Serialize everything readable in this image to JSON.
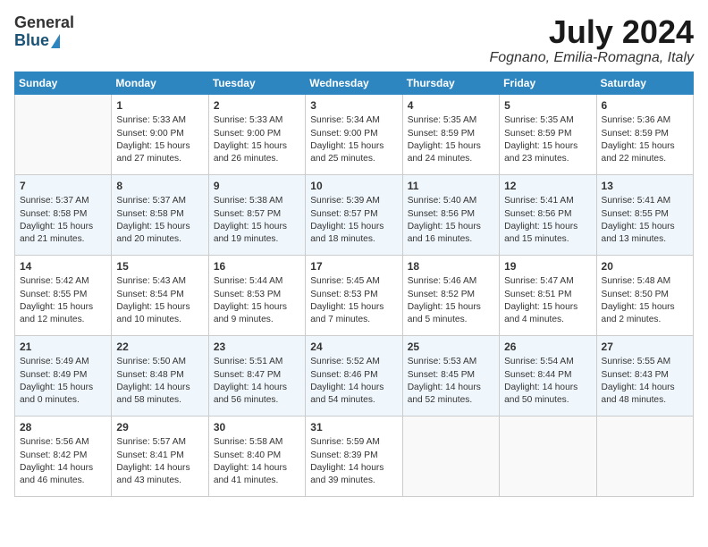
{
  "header": {
    "logo_general": "General",
    "logo_blue": "Blue",
    "month_title": "July 2024",
    "location": "Fognano, Emilia-Romagna, Italy"
  },
  "days_of_week": [
    "Sunday",
    "Monday",
    "Tuesday",
    "Wednesday",
    "Thursday",
    "Friday",
    "Saturday"
  ],
  "weeks": [
    [
      {
        "day": "",
        "info": ""
      },
      {
        "day": "1",
        "info": "Sunrise: 5:33 AM\nSunset: 9:00 PM\nDaylight: 15 hours\nand 27 minutes."
      },
      {
        "day": "2",
        "info": "Sunrise: 5:33 AM\nSunset: 9:00 PM\nDaylight: 15 hours\nand 26 minutes."
      },
      {
        "day": "3",
        "info": "Sunrise: 5:34 AM\nSunset: 9:00 PM\nDaylight: 15 hours\nand 25 minutes."
      },
      {
        "day": "4",
        "info": "Sunrise: 5:35 AM\nSunset: 8:59 PM\nDaylight: 15 hours\nand 24 minutes."
      },
      {
        "day": "5",
        "info": "Sunrise: 5:35 AM\nSunset: 8:59 PM\nDaylight: 15 hours\nand 23 minutes."
      },
      {
        "day": "6",
        "info": "Sunrise: 5:36 AM\nSunset: 8:59 PM\nDaylight: 15 hours\nand 22 minutes."
      }
    ],
    [
      {
        "day": "7",
        "info": "Sunrise: 5:37 AM\nSunset: 8:58 PM\nDaylight: 15 hours\nand 21 minutes."
      },
      {
        "day": "8",
        "info": "Sunrise: 5:37 AM\nSunset: 8:58 PM\nDaylight: 15 hours\nand 20 minutes."
      },
      {
        "day": "9",
        "info": "Sunrise: 5:38 AM\nSunset: 8:57 PM\nDaylight: 15 hours\nand 19 minutes."
      },
      {
        "day": "10",
        "info": "Sunrise: 5:39 AM\nSunset: 8:57 PM\nDaylight: 15 hours\nand 18 minutes."
      },
      {
        "day": "11",
        "info": "Sunrise: 5:40 AM\nSunset: 8:56 PM\nDaylight: 15 hours\nand 16 minutes."
      },
      {
        "day": "12",
        "info": "Sunrise: 5:41 AM\nSunset: 8:56 PM\nDaylight: 15 hours\nand 15 minutes."
      },
      {
        "day": "13",
        "info": "Sunrise: 5:41 AM\nSunset: 8:55 PM\nDaylight: 15 hours\nand 13 minutes."
      }
    ],
    [
      {
        "day": "14",
        "info": "Sunrise: 5:42 AM\nSunset: 8:55 PM\nDaylight: 15 hours\nand 12 minutes."
      },
      {
        "day": "15",
        "info": "Sunrise: 5:43 AM\nSunset: 8:54 PM\nDaylight: 15 hours\nand 10 minutes."
      },
      {
        "day": "16",
        "info": "Sunrise: 5:44 AM\nSunset: 8:53 PM\nDaylight: 15 hours\nand 9 minutes."
      },
      {
        "day": "17",
        "info": "Sunrise: 5:45 AM\nSunset: 8:53 PM\nDaylight: 15 hours\nand 7 minutes."
      },
      {
        "day": "18",
        "info": "Sunrise: 5:46 AM\nSunset: 8:52 PM\nDaylight: 15 hours\nand 5 minutes."
      },
      {
        "day": "19",
        "info": "Sunrise: 5:47 AM\nSunset: 8:51 PM\nDaylight: 15 hours\nand 4 minutes."
      },
      {
        "day": "20",
        "info": "Sunrise: 5:48 AM\nSunset: 8:50 PM\nDaylight: 15 hours\nand 2 minutes."
      }
    ],
    [
      {
        "day": "21",
        "info": "Sunrise: 5:49 AM\nSunset: 8:49 PM\nDaylight: 15 hours\nand 0 minutes."
      },
      {
        "day": "22",
        "info": "Sunrise: 5:50 AM\nSunset: 8:48 PM\nDaylight: 14 hours\nand 58 minutes."
      },
      {
        "day": "23",
        "info": "Sunrise: 5:51 AM\nSunset: 8:47 PM\nDaylight: 14 hours\nand 56 minutes."
      },
      {
        "day": "24",
        "info": "Sunrise: 5:52 AM\nSunset: 8:46 PM\nDaylight: 14 hours\nand 54 minutes."
      },
      {
        "day": "25",
        "info": "Sunrise: 5:53 AM\nSunset: 8:45 PM\nDaylight: 14 hours\nand 52 minutes."
      },
      {
        "day": "26",
        "info": "Sunrise: 5:54 AM\nSunset: 8:44 PM\nDaylight: 14 hours\nand 50 minutes."
      },
      {
        "day": "27",
        "info": "Sunrise: 5:55 AM\nSunset: 8:43 PM\nDaylight: 14 hours\nand 48 minutes."
      }
    ],
    [
      {
        "day": "28",
        "info": "Sunrise: 5:56 AM\nSunset: 8:42 PM\nDaylight: 14 hours\nand 46 minutes."
      },
      {
        "day": "29",
        "info": "Sunrise: 5:57 AM\nSunset: 8:41 PM\nDaylight: 14 hours\nand 43 minutes."
      },
      {
        "day": "30",
        "info": "Sunrise: 5:58 AM\nSunset: 8:40 PM\nDaylight: 14 hours\nand 41 minutes."
      },
      {
        "day": "31",
        "info": "Sunrise: 5:59 AM\nSunset: 8:39 PM\nDaylight: 14 hours\nand 39 minutes."
      },
      {
        "day": "",
        "info": ""
      },
      {
        "day": "",
        "info": ""
      },
      {
        "day": "",
        "info": ""
      }
    ]
  ]
}
